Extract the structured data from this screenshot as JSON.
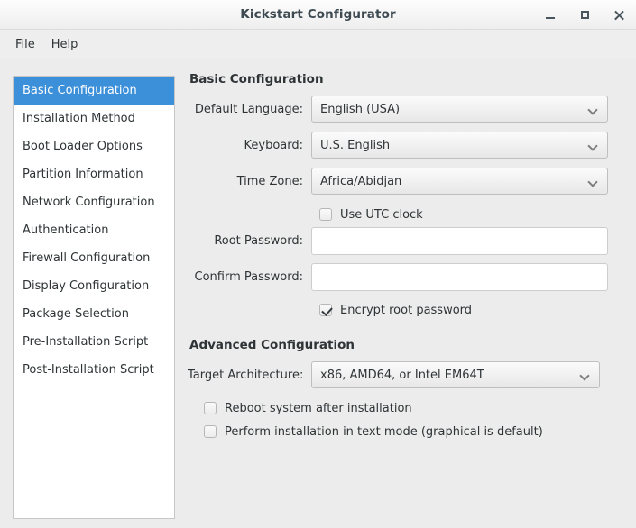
{
  "window": {
    "title": "Kickstart Configurator",
    "controls": {
      "minimize": "minimize",
      "maximize": "maximize",
      "close": "close"
    }
  },
  "menubar": {
    "items": [
      {
        "label": "File"
      },
      {
        "label": "Help"
      }
    ]
  },
  "sidebar": {
    "selected_index": 0,
    "items": [
      {
        "label": "Basic Configuration"
      },
      {
        "label": "Installation Method"
      },
      {
        "label": "Boot Loader Options"
      },
      {
        "label": "Partition Information"
      },
      {
        "label": "Network Configuration"
      },
      {
        "label": "Authentication"
      },
      {
        "label": "Firewall Configuration"
      },
      {
        "label": "Display Configuration"
      },
      {
        "label": "Package Selection"
      },
      {
        "label": "Pre-Installation Script"
      },
      {
        "label": "Post-Installation Script"
      }
    ]
  },
  "basic": {
    "heading": "Basic Configuration",
    "language_label": "Default Language:",
    "language_value": "English (USA)",
    "keyboard_label": "Keyboard:",
    "keyboard_value": "U.S. English",
    "timezone_label": "Time Zone:",
    "timezone_value": "Africa/Abidjan",
    "utc_label": "Use UTC clock",
    "utc_checked": false,
    "root_password_label": "Root Password:",
    "root_password_value": "",
    "root_password_placeholder": "",
    "confirm_password_label": "Confirm Password:",
    "confirm_password_value": "",
    "confirm_password_placeholder": "",
    "encrypt_label": "Encrypt root password",
    "encrypt_checked": true
  },
  "advanced": {
    "heading": "Advanced Configuration",
    "architecture_label": "Target Architecture:",
    "architecture_value": "x86, AMD64, or Intel EM64T",
    "reboot_label": "Reboot system after installation",
    "reboot_checked": false,
    "textmode_label": "Perform installation in text mode (graphical is default)",
    "textmode_checked": false
  },
  "colors": {
    "selection": "#3c8fd9",
    "window_bg": "#edecec",
    "text": "#2e3436",
    "list_bg": "#ffffff"
  }
}
